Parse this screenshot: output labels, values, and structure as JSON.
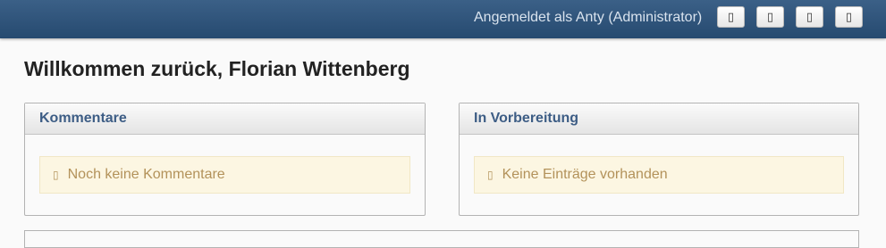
{
  "header": {
    "login_status": "Angemeldet als Anty (Administrator)",
    "buttons": [
      {
        "icon": "icon-1",
        "glyph": "▯"
      },
      {
        "icon": "icon-2",
        "glyph": "▯"
      },
      {
        "icon": "icon-3",
        "glyph": "▯"
      },
      {
        "icon": "icon-4",
        "glyph": "▯"
      }
    ]
  },
  "main": {
    "welcome": "Willkommen zurück, Florian Wittenberg",
    "panels": [
      {
        "title": "Kommentare",
        "notice_icon": "▯",
        "notice": "Noch keine Kommentare"
      },
      {
        "title": "In Vorbereitung",
        "notice_icon": "▯",
        "notice": "Keine Einträge vorhanden"
      }
    ]
  },
  "colors": {
    "topbar": "#2f557d",
    "panel_title": "#3d5d85",
    "notice_bg": "#fcf6e2",
    "notice_text": "#b3925a"
  }
}
